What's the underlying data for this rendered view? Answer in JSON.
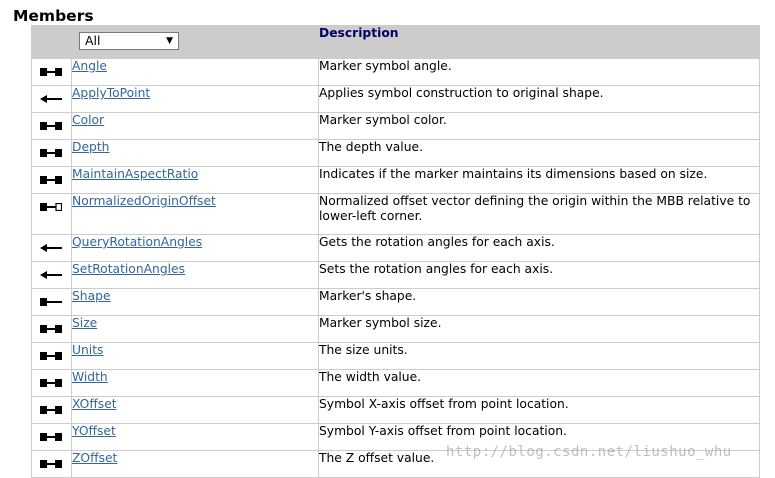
{
  "heading": "Members",
  "filter": {
    "selected": "All"
  },
  "columns": {
    "description": "Description"
  },
  "members": [
    {
      "icon": "read-write-property-icon",
      "name": "Angle",
      "description": "Marker symbol angle."
    },
    {
      "icon": "method-icon",
      "name": "ApplyToPoint",
      "description": "Applies symbol construction to original shape."
    },
    {
      "icon": "read-write-property-icon",
      "name": "Color",
      "description": "Marker symbol color."
    },
    {
      "icon": "read-write-property-icon",
      "name": "Depth",
      "description": "The depth value."
    },
    {
      "icon": "read-write-property-icon",
      "name": "MaintainAspectRatio",
      "description": "Indicates if the marker maintains its dimensions based on size."
    },
    {
      "icon": "write-by-reference-property-icon",
      "name": "NormalizedOriginOffset",
      "description": "Normalized offset vector defining the origin within the MBB relative to lower-left corner."
    },
    {
      "icon": "method-icon",
      "name": "QueryRotationAngles",
      "description": "Gets the rotation angles for each axis."
    },
    {
      "icon": "method-icon",
      "name": "SetRotationAngles",
      "description": "Sets the rotation angles for each axis."
    },
    {
      "icon": "read-only-property-icon",
      "name": "Shape",
      "description": "Marker's shape."
    },
    {
      "icon": "read-write-property-icon",
      "name": "Size",
      "description": "Marker symbol size."
    },
    {
      "icon": "read-write-property-icon",
      "name": "Units",
      "description": "The size units."
    },
    {
      "icon": "read-write-property-icon",
      "name": "Width",
      "description": "The width value."
    },
    {
      "icon": "read-write-property-icon",
      "name": "XOffset",
      "description": "Symbol X-axis offset from point location."
    },
    {
      "icon": "read-write-property-icon",
      "name": "YOffset",
      "description": "Symbol Y-axis offset from point location."
    },
    {
      "icon": "read-write-property-icon",
      "name": "ZOffset",
      "description": "The Z offset value."
    }
  ],
  "watermark": "http://blog.csdn.net/liushuo_whu"
}
